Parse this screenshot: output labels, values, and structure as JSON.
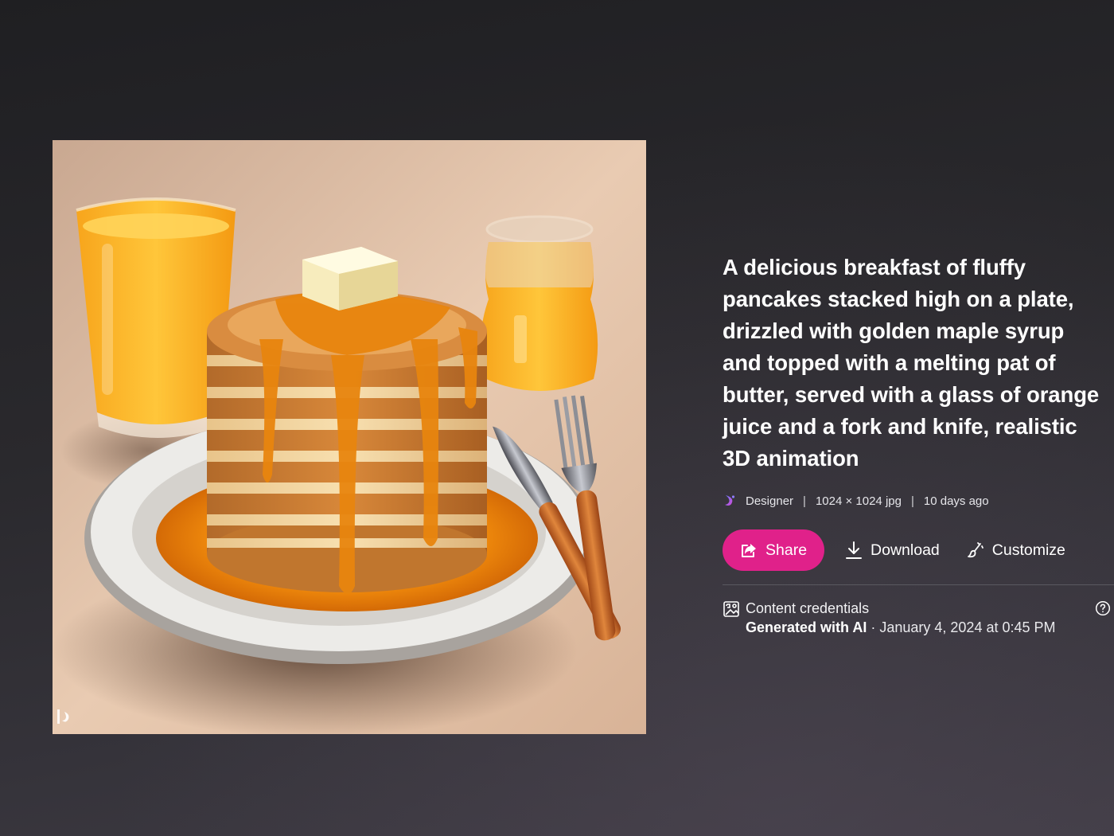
{
  "prompt": "A delicious breakfast of fluffy pancakes stacked high on a plate, drizzled with golden maple syrup and topped with a melting pat of butter, served with a glass of orange juice and a fork and knife, realistic 3D animation",
  "meta": {
    "creator": "Designer",
    "separator": "|",
    "dimensions": "1024 × 1024 jpg",
    "age": "10 days ago"
  },
  "actions": {
    "share": "Share",
    "download": "Download",
    "customize": "Customize"
  },
  "credentials": {
    "title": "Content credentials",
    "generated": "Generated with AI",
    "date": " · January 4, 2024 at 0:45 PM"
  },
  "colors": {
    "accent": "#e0218a",
    "background_top": "#1f1f22",
    "background_bottom": "#403c45",
    "divider": "#5a5960"
  },
  "icons": {
    "creator": "designer-logo-icon",
    "share": "share-icon",
    "download": "download-icon",
    "customize": "customize-brush-icon",
    "credentials": "content-credentials-icon",
    "help": "help-icon",
    "watermark": "designer-watermark-icon"
  }
}
